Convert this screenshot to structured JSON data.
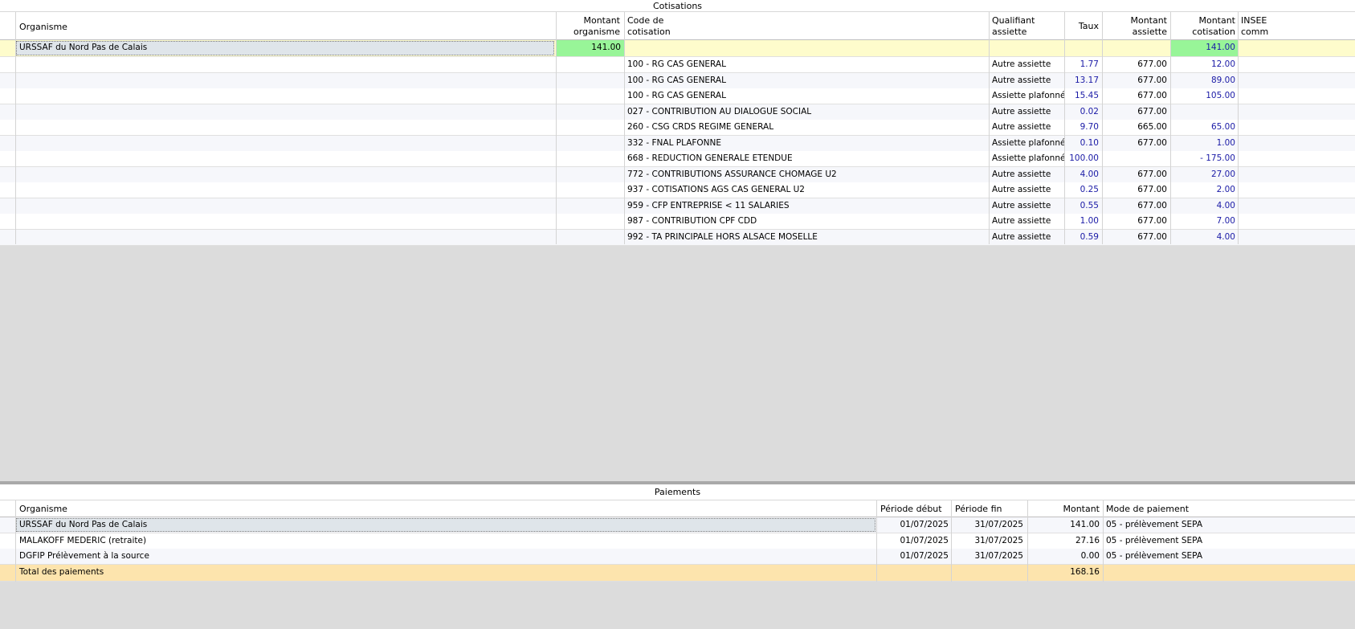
{
  "cotisations": {
    "title": "Cotisations",
    "headers": {
      "organisme": "Organisme",
      "montant_organisme_1": "Montant",
      "montant_organisme_2": "organisme",
      "code_1": "Code de",
      "code_2": "cotisation",
      "qualifiant_1": "Qualifiant",
      "qualifiant_2": "assiette",
      "taux": "Taux",
      "montant_assiette_1": "Montant",
      "montant_assiette_2": "assiette",
      "montant_cotisation_1": "Montant",
      "montant_cotisation_2": "cotisation",
      "insee_1": "INSEE",
      "insee_2": "comm"
    },
    "group_row": {
      "organisme": "URSSAF du Nord Pas de Calais",
      "montant_organisme": "141.00",
      "montant_cotisation": "141.00"
    },
    "rows": [
      {
        "code": "100 - RG CAS GENERAL",
        "qualifiant": "Autre assiette",
        "taux": "1.77",
        "assiette": "677.00",
        "cotisation": "12.00"
      },
      {
        "code": "100 - RG CAS GENERAL",
        "qualifiant": "Autre assiette",
        "taux": "13.17",
        "assiette": "677.00",
        "cotisation": "89.00"
      },
      {
        "code": "100 - RG CAS GENERAL",
        "qualifiant": "Assiette plafonnée",
        "taux": "15.45",
        "assiette": "677.00",
        "cotisation": "105.00"
      },
      {
        "code": "027 - CONTRIBUTION AU DIALOGUE SOCIAL",
        "qualifiant": "Autre assiette",
        "taux": "0.02",
        "assiette": "677.00",
        "cotisation": ""
      },
      {
        "code": "260 - CSG CRDS REGIME GENERAL",
        "qualifiant": "Autre assiette",
        "taux": "9.70",
        "assiette": "665.00",
        "cotisation": "65.00"
      },
      {
        "code": "332 - FNAL PLAFONNE",
        "qualifiant": "Assiette plafonnée",
        "taux": "0.10",
        "assiette": "677.00",
        "cotisation": "1.00"
      },
      {
        "code": "668 - REDUCTION GENERALE ETENDUE",
        "qualifiant": "Assiette plafonnée",
        "taux": "100.00",
        "assiette": "",
        "cotisation": "- 175.00"
      },
      {
        "code": "772 - CONTRIBUTIONS ASSURANCE CHOMAGE U2",
        "qualifiant": "Autre assiette",
        "taux": "4.00",
        "assiette": "677.00",
        "cotisation": "27.00"
      },
      {
        "code": "937 - COTISATIONS AGS CAS GENERAL U2",
        "qualifiant": "Autre assiette",
        "taux": "0.25",
        "assiette": "677.00",
        "cotisation": "2.00"
      },
      {
        "code": "959 - CFP ENTREPRISE < 11 SALARIES",
        "qualifiant": "Autre assiette",
        "taux": "0.55",
        "assiette": "677.00",
        "cotisation": "4.00"
      },
      {
        "code": "987 - CONTRIBUTION CPF CDD",
        "qualifiant": "Autre assiette",
        "taux": "1.00",
        "assiette": "677.00",
        "cotisation": "7.00"
      },
      {
        "code": "992 - TA PRINCIPALE HORS ALSACE MOSELLE",
        "qualifiant": "Autre assiette",
        "taux": "0.59",
        "assiette": "677.00",
        "cotisation": "4.00"
      }
    ]
  },
  "paiements": {
    "title": "Paiements",
    "headers": {
      "organisme": "Organisme",
      "periode_debut": "Période début",
      "periode_fin": "Période fin",
      "montant": "Montant",
      "mode": "Mode de paiement"
    },
    "rows": [
      {
        "organisme": "URSSAF du Nord Pas de Calais",
        "debut": "01/07/2025",
        "fin": "31/07/2025",
        "montant": "141.00",
        "mode": "05 - prélèvement SEPA"
      },
      {
        "organisme": "MALAKOFF MEDERIC (retraite)",
        "debut": "01/07/2025",
        "fin": "31/07/2025",
        "montant": "27.16",
        "mode": "05 - prélèvement SEPA"
      },
      {
        "organisme": "DGFIP Prélèvement à la source",
        "debut": "01/07/2025",
        "fin": "31/07/2025",
        "montant": "0.00",
        "mode": "05 - prélèvement SEPA"
      }
    ],
    "total": {
      "label": "Total des paiements",
      "montant": "168.16"
    }
  },
  "colors": {
    "highlight_row": "#fefccc",
    "green_cell": "#98f598",
    "total_row": "#fde4ad",
    "blue_value": "#1a1aa6"
  }
}
